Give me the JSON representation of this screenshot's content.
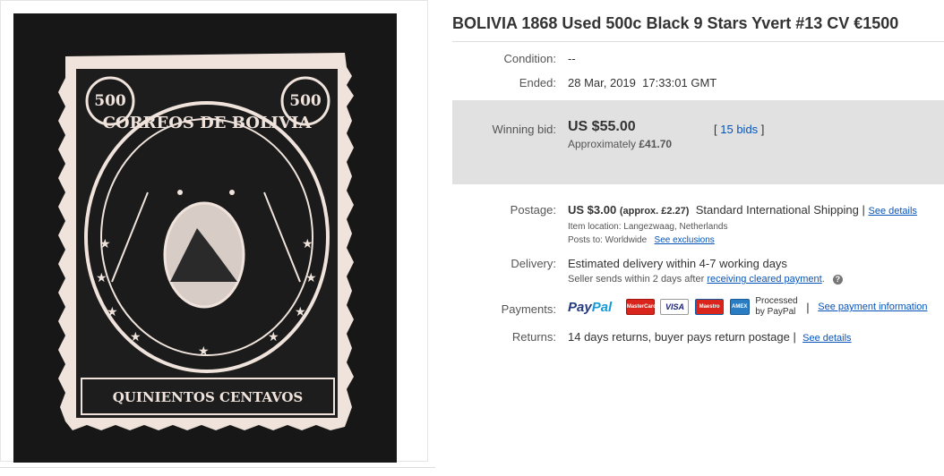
{
  "listing": {
    "title": "BOLIVIA 1868 Used 500c Black 9 Stars Yvert #13 CV €1500"
  },
  "image": {
    "stamp_top_left": "500",
    "stamp_top_right": "500",
    "stamp_arc_text": "CORREOS DE BOLIVIA",
    "stamp_bottom_text": "QUINIENTOS CENTAVOS"
  },
  "condition": {
    "label": "Condition:",
    "value": "--"
  },
  "ended": {
    "label": "Ended:",
    "date": "28 Mar, 2019",
    "time": "17:33:01 GMT"
  },
  "bid": {
    "label": "Winning bid:",
    "amount": "US $55.00",
    "approx_prefix": "Approximately ",
    "approx_value": "£41.70",
    "bids_open": "[",
    "bids_link": "15 bids",
    "bids_close": "]"
  },
  "postage": {
    "label": "Postage:",
    "price": "US $3.00",
    "approx": "(approx. £2.27)",
    "service": "Standard International Shipping",
    "divider": "|",
    "details_link": "See details",
    "location": "Item location:  Langezwaag, Netherlands",
    "posts_to_label": "Posts to:  Worldwide",
    "exclusions_link": "See exclusions"
  },
  "delivery": {
    "label": "Delivery:",
    "estimate": "Estimated delivery within 4-7 working days",
    "dispatch_prefix": "Seller sends within 2 days after ",
    "dispatch_link": "receiving cleared payment",
    "dispatch_suffix": ".",
    "help_icon": "?"
  },
  "payments": {
    "label": "Payments:",
    "paypal_pay": "Pay",
    "paypal_pal": "Pal",
    "mastercard": "MasterCard",
    "visa": "VISA",
    "maestro": "Maestro",
    "amex": "AMEX",
    "processed_line1": "Processed",
    "processed_line2": "by PayPal",
    "divider": "|",
    "info_link": "See payment information"
  },
  "returns": {
    "label": "Returns:",
    "value": "14 days returns, buyer pays return postage",
    "divider": "|",
    "details_link": "See details"
  },
  "colors": {
    "link": "#0654ba",
    "bid_box": "#e1e1e1",
    "stamp_paper": "#efe3dc",
    "stamp_ink": "#171717"
  }
}
